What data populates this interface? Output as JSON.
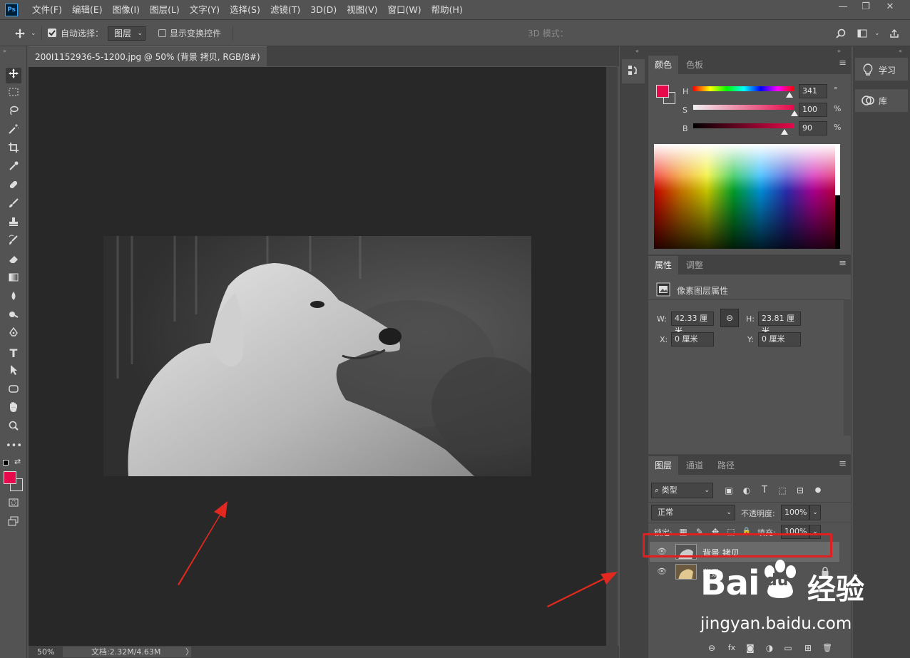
{
  "app": {
    "logo_text": "Ps"
  },
  "menu": [
    "文件(F)",
    "编辑(E)",
    "图像(I)",
    "图层(L)",
    "文字(Y)",
    "选择(S)",
    "滤镜(T)",
    "3D(D)",
    "视图(V)",
    "窗口(W)",
    "帮助(H)"
  ],
  "window_controls": {
    "minimize": "—",
    "restore": "❐",
    "close": "✕"
  },
  "options": {
    "auto_select_label": "自动选择：",
    "auto_select_checked": true,
    "auto_select_target": "图层",
    "show_transform_label": "显示变换控件",
    "mode3d_label": "3D 模式："
  },
  "document": {
    "tab_title": "200I1152936-5-1200.jpg @ 50% (背景 拷贝, RGB/8#) *",
    "close": "✕",
    "zoom": "50%",
    "doc_info": "文档:2.32M/4.63M",
    "status_arrow": "〉"
  },
  "color_panel": {
    "tabs": [
      "颜色",
      "色板"
    ],
    "fg_color": "#e6094b",
    "bg_color": "#535353",
    "h_label": "H",
    "h_value": "341",
    "h_unit": "°",
    "s_label": "S",
    "s_value": "100",
    "s_unit": "%",
    "b_label": "B",
    "b_value": "90",
    "b_unit": "%"
  },
  "properties_panel": {
    "tabs": [
      "属性",
      "调整"
    ],
    "title": "像素图层属性",
    "w_label": "W:",
    "w_value": "42.33 厘米",
    "h_label": "H:",
    "h_value": "23.81 厘米",
    "x_label": "X:",
    "x_value": "0 厘米",
    "y_label": "Y:",
    "y_value": "0 厘米"
  },
  "layers_panel": {
    "tabs": [
      "图层",
      "通道",
      "路径"
    ],
    "filter_type": "类型",
    "blend_mode": "正常",
    "opacity_label": "不透明度:",
    "opacity_value": "100%",
    "lock_label": "锁定:",
    "fill_label": "填充:",
    "fill_value": "100%",
    "layers": [
      {
        "name": "背景 拷贝",
        "selected": true,
        "locked": false
      },
      {
        "name": "背景",
        "selected": false,
        "locked": true
      }
    ]
  },
  "right_dock": {
    "learn_label": "学习",
    "library_label": "库"
  },
  "watermark": {
    "brand": "Bai",
    "brand2": "du",
    "cn": "经验",
    "url": "jingyan.baidu.com"
  },
  "accent_colors": {
    "annotation_red": "#e3291f",
    "highlight_box": "#e02020"
  }
}
